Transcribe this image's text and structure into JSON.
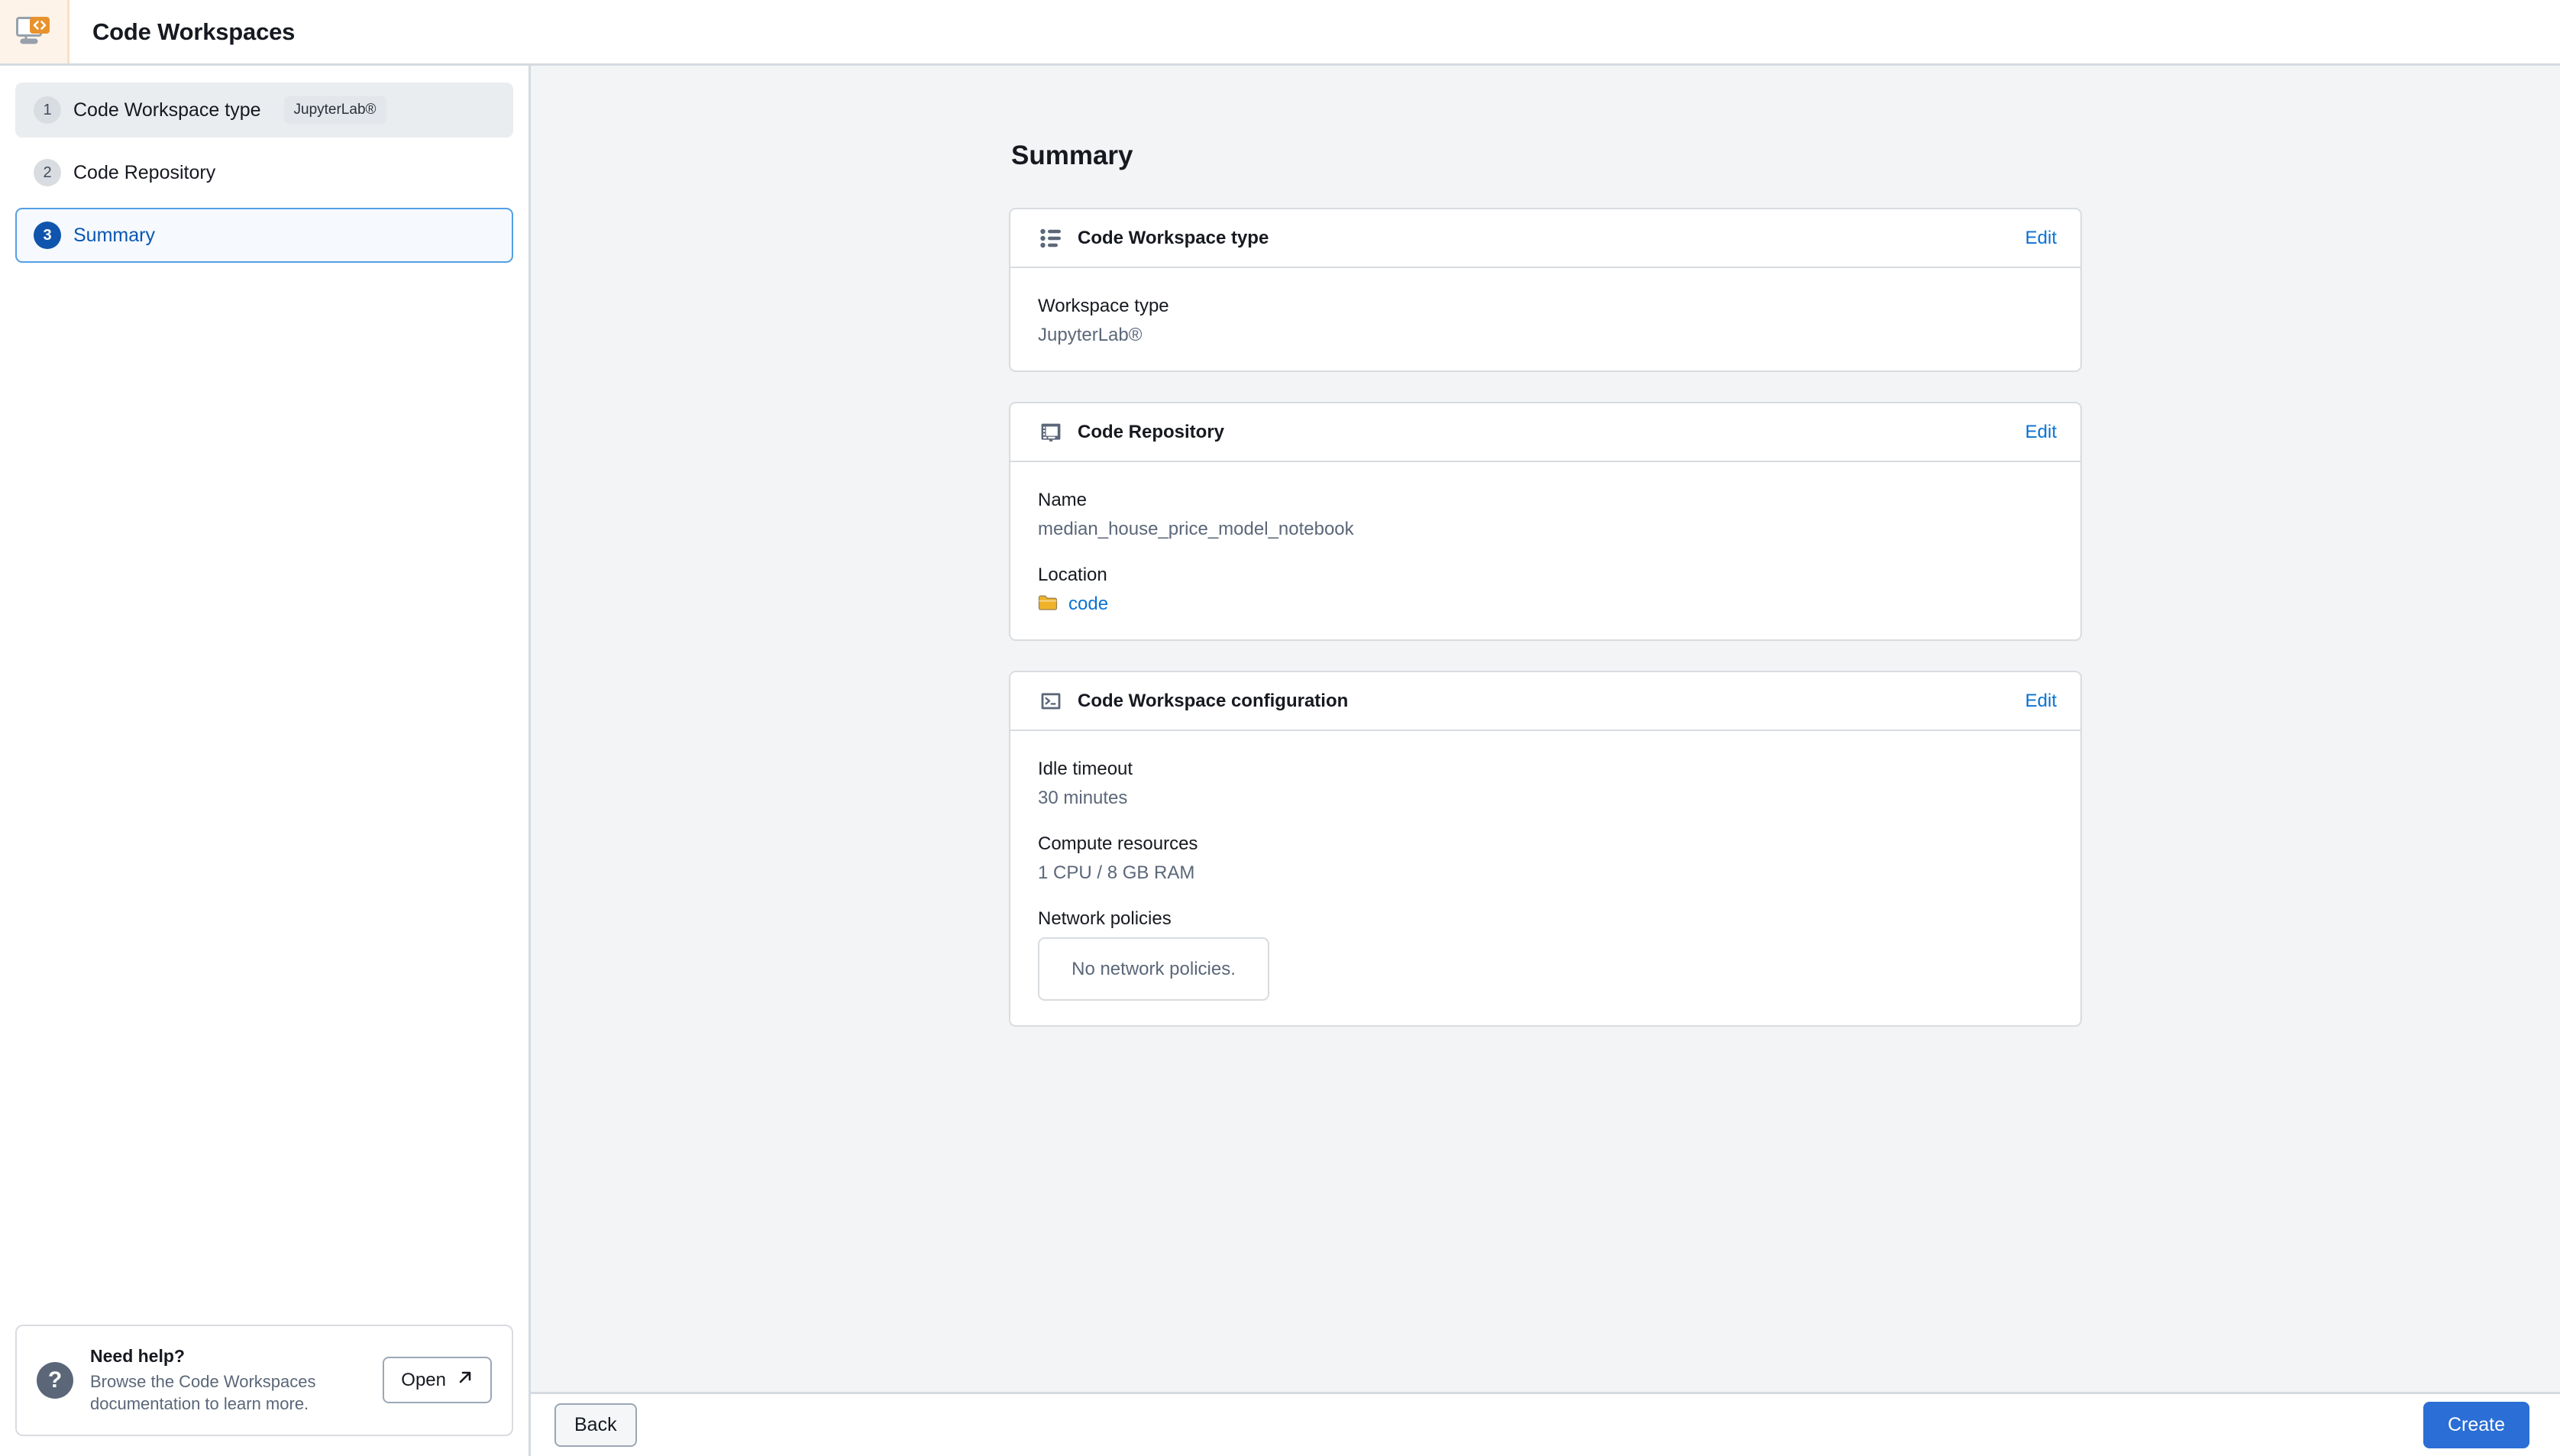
{
  "app": {
    "title": "Code Workspaces",
    "logo_icon": "code-workspace-monitor-icon"
  },
  "sidebar": {
    "steps": [
      {
        "number": "1",
        "label": "Code Workspace type",
        "chip": "JupyterLab®",
        "state": "visited"
      },
      {
        "number": "2",
        "label": "Code Repository",
        "chip": "",
        "state": "plain"
      },
      {
        "number": "3",
        "label": "Summary",
        "chip": "",
        "state": "current"
      }
    ],
    "help": {
      "icon": "question-mark-icon",
      "title": "Need help?",
      "description": "Browse the Code Workspaces documentation to learn more.",
      "button_label": "Open",
      "button_icon": "external-link-icon"
    }
  },
  "main": {
    "page_title": "Summary",
    "cards": [
      {
        "icon": "bulleted-list-icon",
        "title": "Code Workspace type",
        "edit_label": "Edit",
        "fields": [
          {
            "label": "Workspace type",
            "value": "JupyterLab®",
            "style": "plain"
          }
        ]
      },
      {
        "icon": "notebook-icon",
        "title": "Code Repository",
        "edit_label": "Edit",
        "fields": [
          {
            "label": "Name",
            "value": "median_house_price_model_notebook",
            "style": "plain"
          },
          {
            "label": "Location",
            "value": "code",
            "style": "folder-link"
          }
        ]
      },
      {
        "icon": "terminal-icon",
        "title": "Code Workspace configuration",
        "edit_label": "Edit",
        "fields": [
          {
            "label": "Idle timeout",
            "value": "30 minutes",
            "style": "plain"
          },
          {
            "label": "Compute resources",
            "value": "1 CPU / 8 GB RAM",
            "style": "plain"
          },
          {
            "label": "Network policies",
            "value": "No network policies.",
            "style": "empty-box"
          }
        ]
      }
    ]
  },
  "actionbar": {
    "back_label": "Back",
    "create_label": "Create"
  },
  "colors": {
    "accent_blue": "#0972d3",
    "primary_button": "#2a6ed6",
    "logo_orange": "#e8922e",
    "logo_bg": "#fdf3e9",
    "main_bg": "#f3f4f6",
    "folder_yellow": "#efb229"
  }
}
